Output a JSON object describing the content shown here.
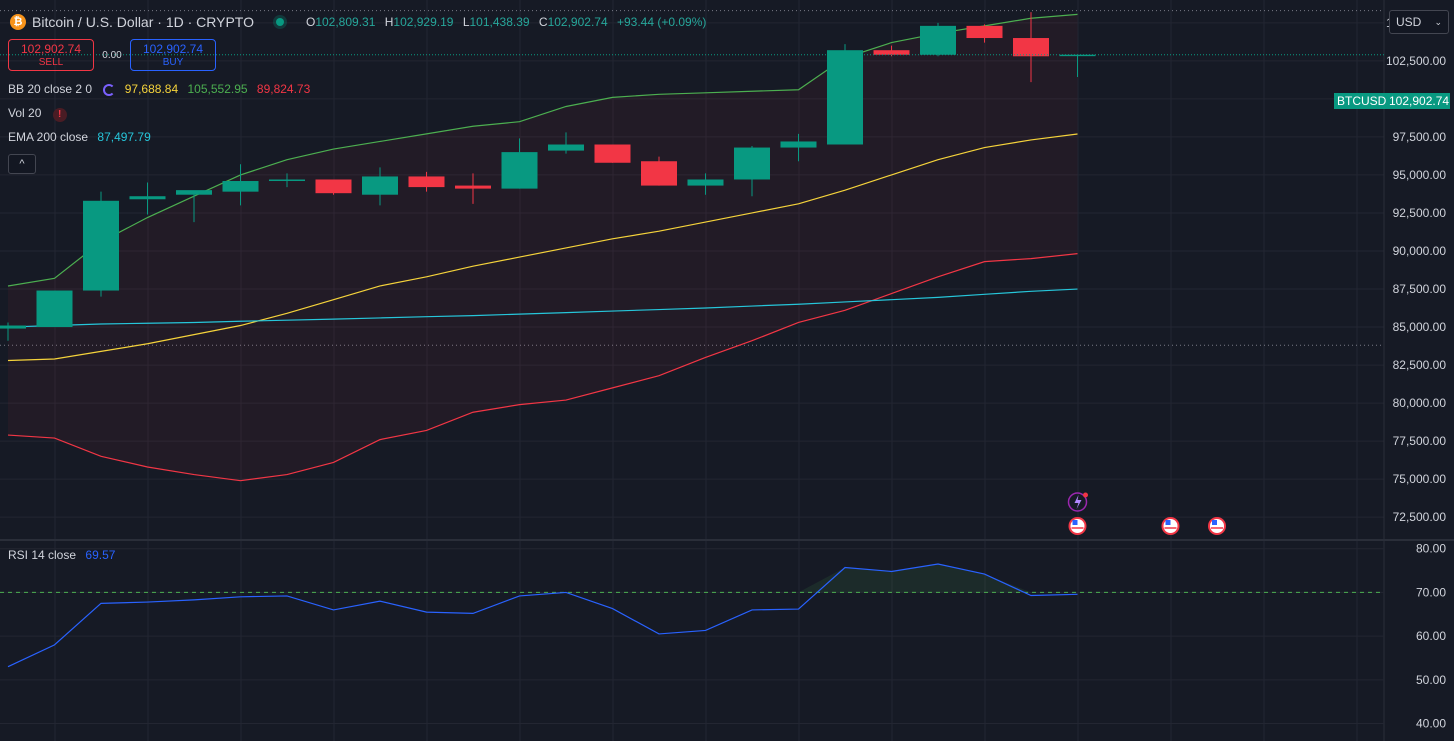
{
  "header": {
    "symbol_title": "Bitcoin / U.S. Dollar · 1D · CRYPTO",
    "coin_glyph": "₿",
    "ohlc": [
      {
        "k": "O",
        "v": "102,809.31"
      },
      {
        "k": "H",
        "v": "102,929.19"
      },
      {
        "k": "L",
        "v": "101,438.39"
      },
      {
        "k": "C",
        "v": "102,902.74"
      }
    ],
    "change": "+93.44 (+0.09%)"
  },
  "currency": {
    "label": "USD",
    "icon": "chevron-down-icon"
  },
  "trade": {
    "sell_price": "102,902.74",
    "sell_label": "SELL",
    "spread": "0.00",
    "buy_price": "102,902.74",
    "buy_label": "BUY"
  },
  "indicators": {
    "bb": {
      "name": "BB 20 close 2 0",
      "basis": "97,688.84",
      "upper": "105,552.95",
      "lower": "89,824.73"
    },
    "vol": {
      "name": "Vol 20",
      "warn": "!"
    },
    "ema": {
      "name": "EMA 200 close",
      "value": "87,497.79"
    },
    "collapse": "^"
  },
  "price_tag": {
    "symbol": "BTCUSD",
    "price": "102,902.74"
  },
  "rsi": {
    "name": "RSI 14 close",
    "value": "69.57"
  },
  "colors": {
    "up": "#089981",
    "down": "#f23645",
    "bb_upper": "#4caf50",
    "bb_basis": "#f5d33b",
    "bb_lower": "#f23645",
    "ema": "#26c6da",
    "rsi": "#2962ff",
    "grid": "#232632",
    "bg": "#161a25"
  },
  "chart_data": [
    {
      "type": "candlestick",
      "title": "Bitcoin / U.S. Dollar · 1D · CRYPTO",
      "ylim": [
        71000,
        106500
      ],
      "yticks": [
        72500,
        75000,
        77500,
        80000,
        82500,
        85000,
        87500,
        90000,
        92500,
        95000,
        97500,
        100000,
        102500,
        105000
      ],
      "ytick_labels": [
        "72,500.00",
        "75,000.00",
        "77,500.00",
        "80,000.00",
        "82,500.00",
        "85,000.00",
        "87,500.00",
        "90,000.00",
        "92,500.00",
        "95,000.00",
        "97,500.00",
        "100,000.00",
        "102,500.00",
        "105,000.00"
      ],
      "grid": true,
      "candles": [
        {
          "o": 84900,
          "h": 85300,
          "l": 84100,
          "c": 85100
        },
        {
          "o": 85000,
          "h": 85000,
          "l": 85000,
          "c": 87400
        },
        {
          "o": 87400,
          "h": 93900,
          "l": 87000,
          "c": 93300
        },
        {
          "o": 93400,
          "h": 94500,
          "l": 92400,
          "c": 93600
        },
        {
          "o": 93700,
          "h": 93900,
          "l": 91900,
          "c": 94000
        },
        {
          "o": 93900,
          "h": 95700,
          "l": 93000,
          "c": 94600
        },
        {
          "o": 94600,
          "h": 95100,
          "l": 94200,
          "c": 94700
        },
        {
          "o": 94700,
          "h": 94700,
          "l": 93700,
          "c": 93800
        },
        {
          "o": 93700,
          "h": 95500,
          "l": 93000,
          "c": 94900
        },
        {
          "o": 94900,
          "h": 95200,
          "l": 93900,
          "c": 94200
        },
        {
          "o": 94300,
          "h": 95100,
          "l": 93100,
          "c": 94100
        },
        {
          "o": 94100,
          "h": 97400,
          "l": 94100,
          "c": 96500
        },
        {
          "o": 96600,
          "h": 97800,
          "l": 96400,
          "c": 97000
        },
        {
          "o": 97000,
          "h": 97000,
          "l": 95800,
          "c": 95800
        },
        {
          "o": 95900,
          "h": 96200,
          "l": 94300,
          "c": 94300
        },
        {
          "o": 94300,
          "h": 95100,
          "l": 93700,
          "c": 94700
        },
        {
          "o": 94700,
          "h": 96900,
          "l": 93600,
          "c": 96800
        },
        {
          "o": 96800,
          "h": 97700,
          "l": 95900,
          "c": 97200
        },
        {
          "o": 97000,
          "h": 103600,
          "l": 97000,
          "c": 103200
        },
        {
          "o": 103200,
          "h": 103500,
          "l": 102800,
          "c": 102900
        },
        {
          "o": 102900,
          "h": 105000,
          "l": 102800,
          "c": 104800
        },
        {
          "o": 104800,
          "h": 104900,
          "l": 103700,
          "c": 104000
        },
        {
          "o": 104000,
          "h": 105700,
          "l": 101100,
          "c": 102800
        },
        {
          "o": 102809.31,
          "h": 102929.19,
          "l": 101438.39,
          "c": 102902.74
        }
      ],
      "series": [
        {
          "name": "BB upper",
          "values": [
            87700,
            88200,
            90600,
            92200,
            93600,
            95000,
            96000,
            96700,
            97200,
            97700,
            98200,
            98500,
            99500,
            100100,
            100300,
            100400,
            100500,
            100600,
            102700,
            103700,
            104300,
            104800,
            105300,
            105552.95
          ]
        },
        {
          "name": "BB basis",
          "values": [
            82800,
            82900,
            83400,
            83900,
            84500,
            85100,
            85900,
            86800,
            87700,
            88300,
            89000,
            89600,
            90200,
            90800,
            91300,
            91900,
            92500,
            93100,
            94000,
            95000,
            96000,
            96800,
            97300,
            97688.84
          ]
        },
        {
          "name": "BB lower",
          "values": [
            77900,
            77700,
            76500,
            75800,
            75300,
            74900,
            75300,
            76100,
            77600,
            78200,
            79400,
            79900,
            80200,
            81000,
            81800,
            83000,
            84100,
            85300,
            86100,
            87200,
            88300,
            89300,
            89500,
            89824.73
          ]
        },
        {
          "name": "EMA 200",
          "values": [
            85000,
            85100,
            85200,
            85250,
            85300,
            85380,
            85450,
            85520,
            85600,
            85680,
            85750,
            85850,
            85950,
            86050,
            86150,
            86250,
            86380,
            86500,
            86650,
            86800,
            86950,
            87150,
            87350,
            87497.79
          ]
        }
      ],
      "markers": [
        "us-flag-icon",
        "us-flag-icon",
        "us-flag-icon",
        "lightning-icon"
      ]
    },
    {
      "type": "line",
      "title": "RSI 14 close",
      "ylim": [
        36,
        82
      ],
      "yticks": [
        40,
        50,
        60,
        70,
        80
      ],
      "ytick_labels": [
        "40.00",
        "50.00",
        "60.00",
        "70.00",
        "80.00"
      ],
      "reference_line": 70,
      "series": [
        {
          "name": "RSI 14",
          "values": [
            53,
            58,
            67.5,
            67.8,
            68.3,
            69,
            69.2,
            66,
            68,
            65.5,
            65.2,
            69.2,
            70,
            66.3,
            60.5,
            61.3,
            66,
            66.2,
            75.7,
            74.8,
            76.5,
            74.2,
            69.3,
            69.57
          ]
        }
      ]
    }
  ]
}
